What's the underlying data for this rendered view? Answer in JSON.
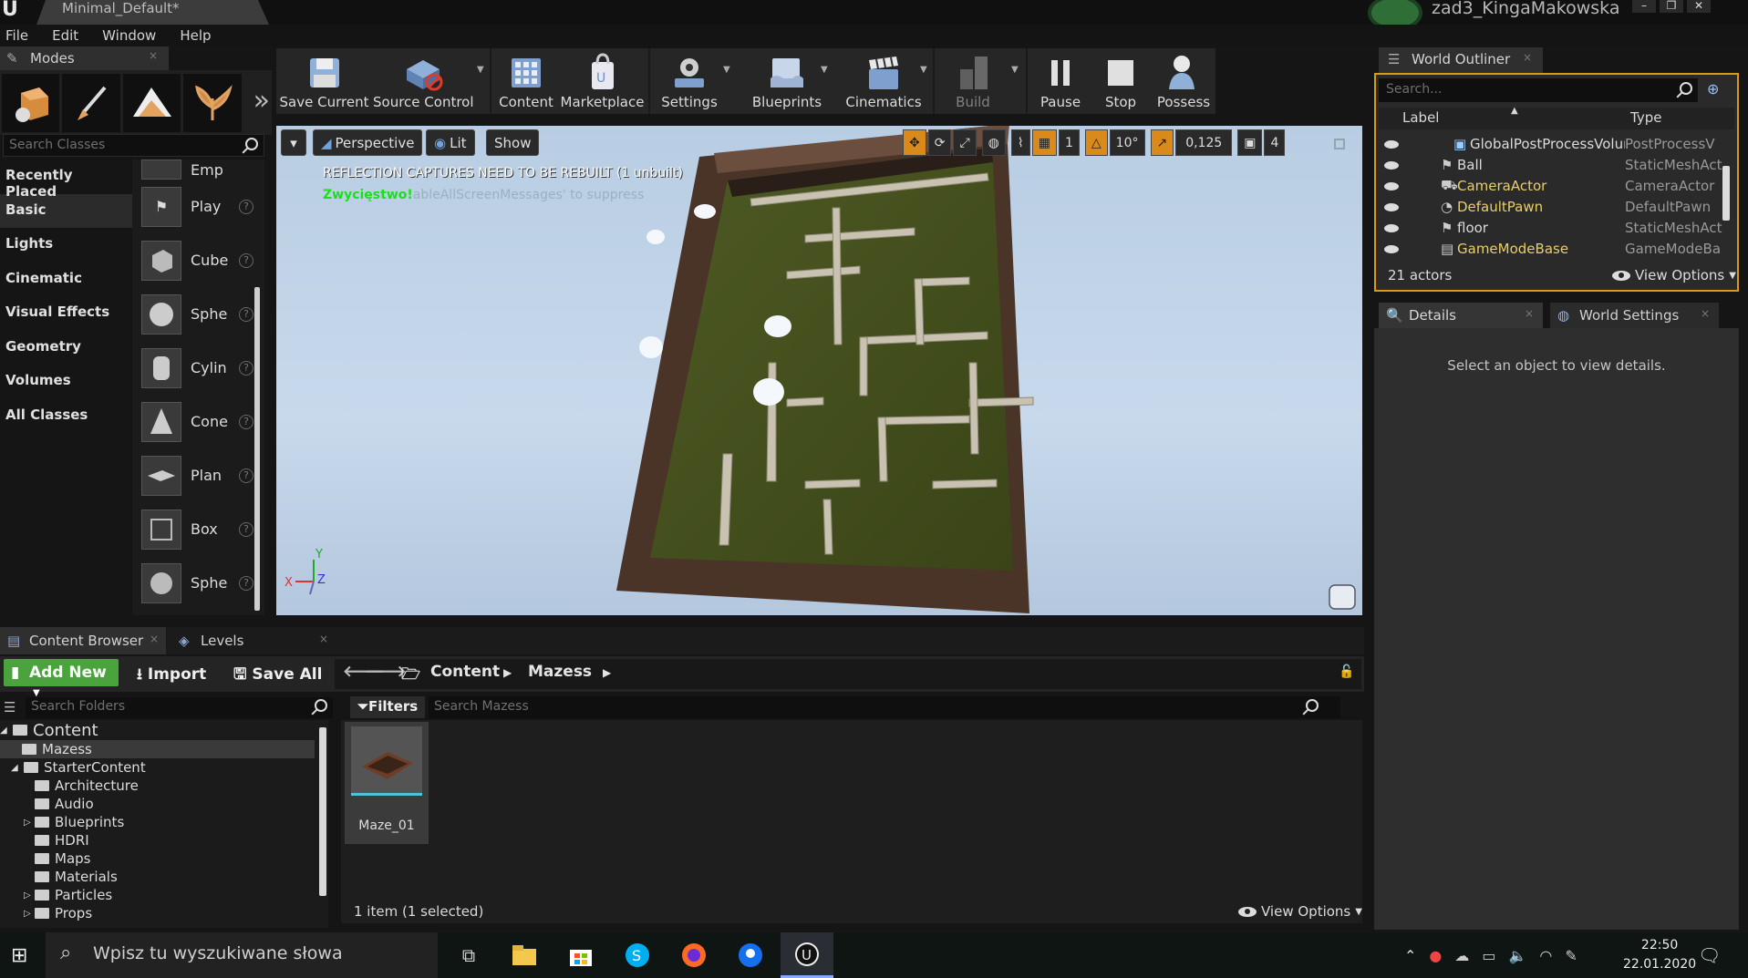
{
  "window": {
    "tab_title": "Minimal_Default*",
    "project_name": "zad3_KingaMakowska"
  },
  "menu": [
    "File",
    "Edit",
    "Window",
    "Help"
  ],
  "modes": {
    "tab_label": "Modes",
    "search_placeholder": "Search Classes",
    "categories": [
      "Recently Placed",
      "Basic",
      "Lights",
      "Cinematic",
      "Visual Effects",
      "Geometry",
      "Volumes",
      "All Classes"
    ],
    "selected_category": "Basic",
    "place_items": [
      "Emp",
      "Play",
      "Cube",
      "Sphe",
      "Cylin",
      "Cone",
      "Plan",
      "Box",
      "Sphe"
    ]
  },
  "toolbar": {
    "items": [
      {
        "label": "Save Current",
        "icon": "save-icon"
      },
      {
        "label": "Source Control",
        "icon": "source-control-icon"
      },
      {
        "label": "Content",
        "icon": "content-icon"
      },
      {
        "label": "Marketplace",
        "icon": "marketplace-icon"
      },
      {
        "label": "Settings",
        "icon": "settings-icon"
      },
      {
        "label": "Blueprints",
        "icon": "blueprints-icon"
      },
      {
        "label": "Cinematics",
        "icon": "cinematics-icon"
      },
      {
        "label": "Build",
        "icon": "build-icon"
      },
      {
        "label": "Pause",
        "icon": "pause-icon"
      },
      {
        "label": "Stop",
        "icon": "stop-icon"
      },
      {
        "label": "Possess",
        "icon": "possess-icon"
      }
    ]
  },
  "viewport": {
    "perspective_label": "Perspective",
    "lit_label": "Lit",
    "show_label": "Show",
    "message_reflection": "REFLECTION CAPTURES NEED TO BE REBUILT (1 unbuilt)",
    "message_win": "Zwycięstwo!",
    "message_suppress": "ableAllScreenMessages' to suppress",
    "grid_snap": "1",
    "rotation_snap": "10°",
    "scale_snap": "0,125",
    "camera_speed": "4",
    "axis_labels": {
      "x": "X",
      "y": "Y",
      "z": "Z"
    }
  },
  "content_browser": {
    "tab_label": "Content Browser",
    "levels_tab_label": "Levels",
    "add_new": "Add New",
    "import": "Import",
    "save_all": "Save All",
    "path": [
      "Content",
      "Mazess"
    ],
    "search_folders_placeholder": "Search Folders",
    "filters_label": "Filters",
    "search_assets_placeholder": "Search Mazess",
    "folders": [
      {
        "name": "Content",
        "level": 0
      },
      {
        "name": "Mazess",
        "level": 1,
        "selected": true
      },
      {
        "name": "StarterContent",
        "level": 1
      },
      {
        "name": "Architecture",
        "level": 2
      },
      {
        "name": "Audio",
        "level": 2
      },
      {
        "name": "Blueprints",
        "level": 2
      },
      {
        "name": "HDRI",
        "level": 2
      },
      {
        "name": "Maps",
        "level": 2
      },
      {
        "name": "Materials",
        "level": 2
      },
      {
        "name": "Particles",
        "level": 2
      },
      {
        "name": "Props",
        "level": 2
      }
    ],
    "assets": [
      {
        "name": "Maze_01"
      }
    ],
    "status": "1 item (1 selected)",
    "view_options": "View Options"
  },
  "world_outliner": {
    "tab_label": "World Outliner",
    "search_placeholder": "Search...",
    "col_label": "Label",
    "col_type": "Type",
    "rows": [
      {
        "label": "GlobalPostProcessVolur",
        "type": "PostProcessV",
        "color": "#dcdcdc"
      },
      {
        "label": "Ball",
        "type": "StaticMeshAct",
        "color": "#dcdcdc"
      },
      {
        "label": "CameraActor",
        "type": "CameraActor",
        "color": "#e8cf6a"
      },
      {
        "label": "DefaultPawn",
        "type": "DefaultPawn",
        "color": "#e8cf6a"
      },
      {
        "label": "floor",
        "type": "StaticMeshAct",
        "color": "#dcdcdc"
      },
      {
        "label": "GameModeBase",
        "type": "GameModeBa",
        "color": "#e8cf6a"
      }
    ],
    "actor_count": "21 actors",
    "view_options": "View Options"
  },
  "details": {
    "tab_label": "Details",
    "world_settings_tab": "World Settings",
    "empty_message": "Select an object to view details."
  },
  "taskbar": {
    "search_placeholder": "Wpisz tu wyszukiwane słowa",
    "time": "22:50",
    "date": "22.01.2020"
  },
  "colors": {
    "accent_green": "#4ba33d",
    "outliner_border": "#d99a18",
    "snap_orange": "#d98a1a"
  }
}
